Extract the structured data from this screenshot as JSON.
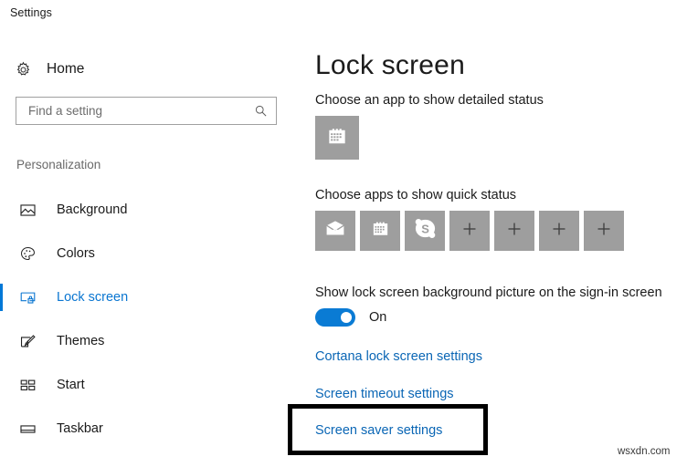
{
  "window": {
    "title": "Settings"
  },
  "nav": {
    "home": {
      "label": "Home",
      "icon": "gear-icon"
    },
    "search": {
      "placeholder": "Find a setting",
      "value": "",
      "icon": "search-icon"
    },
    "group_label": "Personalization",
    "items": [
      {
        "label": "Background",
        "icon": "picture-icon",
        "selected": false
      },
      {
        "label": "Colors",
        "icon": "palette-icon",
        "selected": false
      },
      {
        "label": "Lock screen",
        "icon": "lock-screen-icon",
        "selected": true
      },
      {
        "label": "Themes",
        "icon": "brush-icon",
        "selected": false
      },
      {
        "label": "Start",
        "icon": "start-tiles-icon",
        "selected": false
      },
      {
        "label": "Taskbar",
        "icon": "taskbar-icon",
        "selected": false
      }
    ]
  },
  "content": {
    "page_title": "Lock screen",
    "detailed_status": {
      "label": "Choose an app to show detailed status",
      "tile": {
        "icon": "calendar-icon",
        "name": "Calendar"
      }
    },
    "quick_status": {
      "label": "Choose apps to show quick status",
      "tiles": [
        {
          "icon": "mail-icon",
          "name": "Mail"
        },
        {
          "icon": "calendar-icon",
          "name": "Calendar"
        },
        {
          "icon": "skype-icon",
          "name": "Skype"
        },
        {
          "icon": "plus-icon",
          "name": "Add app"
        },
        {
          "icon": "plus-icon",
          "name": "Add app"
        },
        {
          "icon": "plus-icon",
          "name": "Add app"
        },
        {
          "icon": "plus-icon",
          "name": "Add app"
        }
      ]
    },
    "signin": {
      "label": "Show lock screen background picture on the sign-in screen",
      "toggle_state": "On"
    },
    "links": [
      {
        "label": "Cortana lock screen settings"
      },
      {
        "label": "Screen timeout settings"
      },
      {
        "label": "Screen saver settings",
        "highlighted": true
      }
    ]
  },
  "watermark": "wsxdn.com",
  "colors": {
    "accent": "#0078d7",
    "link": "#0a66b5",
    "tile": "#9e9e9e",
    "annotation": "#000000"
  }
}
